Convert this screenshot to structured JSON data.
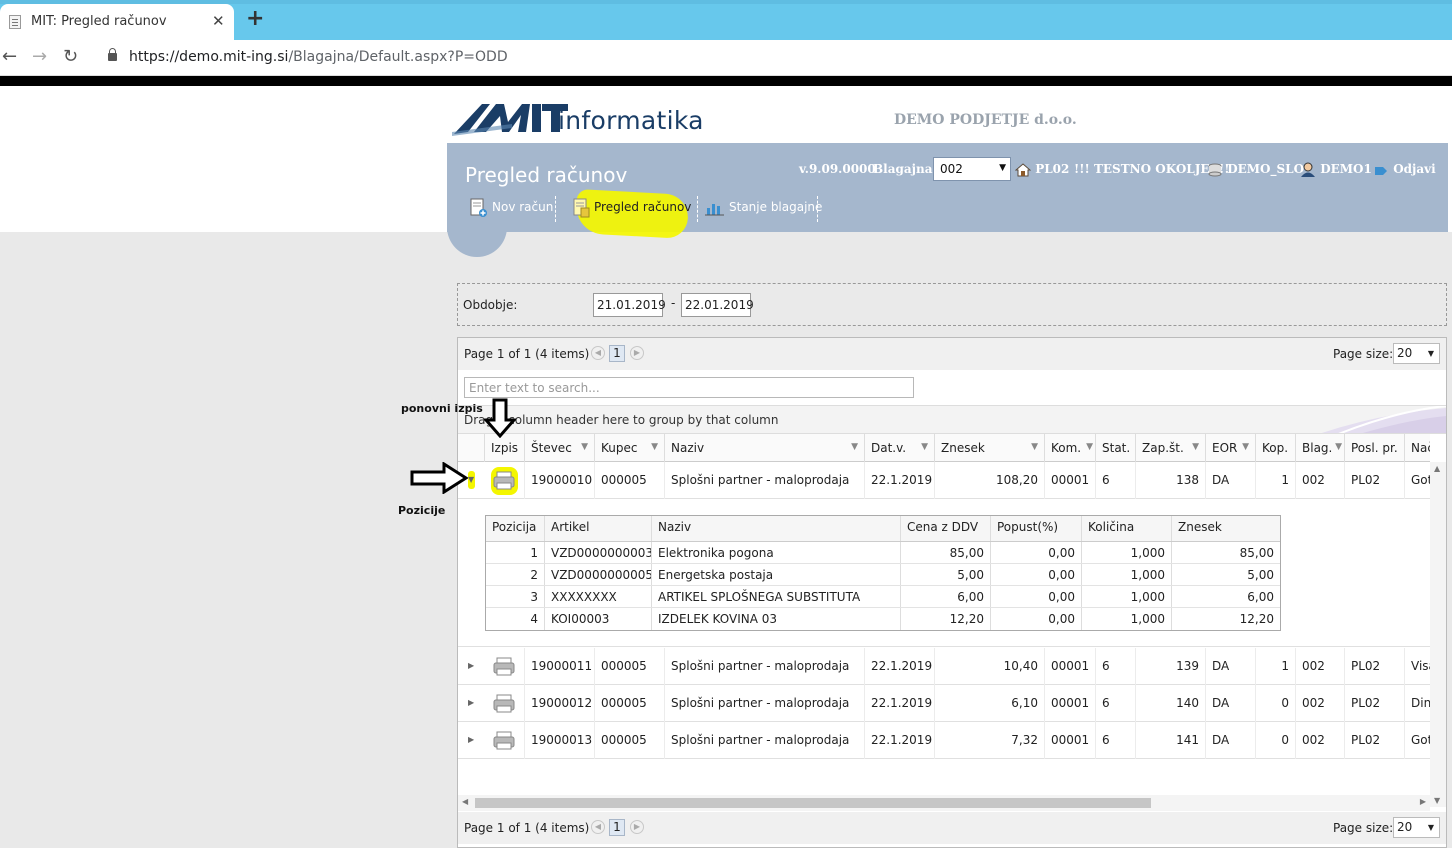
{
  "browser": {
    "tab_title": "MIT: Pregled računov",
    "url_host": "https://demo.mit-ing.si",
    "url_path": "/Blagajna/Default.aspx?P=ODD"
  },
  "brand": {
    "logo_text": "informatika",
    "company": "DEMO PODJETJE d.o.o."
  },
  "header": {
    "page_title": "Pregled računov",
    "version": "v.9.09.0000",
    "register_label": "Blagajna",
    "register_value": "002",
    "home_label": "PL02",
    "env_label": "!!! TESTNO OKOLJE !!!",
    "db_label": "DEMO_SLO",
    "user_label": "DEMO1",
    "logout_label": "Odjavi"
  },
  "menu": {
    "new_invoice": "Nov račun",
    "invoice_review": "Pregled računov",
    "cash_state": "Stanje blagajne"
  },
  "filter": {
    "period_label": "Obdobje:",
    "date_from": "21.01.2019",
    "date_to": "22.01.2019",
    "sep": "-"
  },
  "pager": {
    "info": "Page 1 of 1 (4 items)",
    "page": "1",
    "size_label": "Page size:",
    "size_value": "20"
  },
  "search": {
    "placeholder": "Enter text to search..."
  },
  "group_hint": "Drag a column header here to group by that column",
  "columns": [
    "Izpis",
    "Števec",
    "Kupec",
    "Naziv",
    "Dat.v.",
    "Znesek",
    "Kom.",
    "Stat.",
    "Zap.št.",
    "EOR",
    "Kop.",
    "Blag.",
    "Posl. pr.",
    "Nač"
  ],
  "rows": [
    {
      "stevec": "19000010",
      "kupec": "000005",
      "naziv": "Splošni partner - maloprodaja",
      "datum": "22.1.2019",
      "znesek": "108,20",
      "kom": "00001",
      "stat": "6",
      "zap": "138",
      "eor": "DA",
      "kop": "1",
      "blag": "002",
      "posl": "PL02",
      "nac": "Got"
    },
    {
      "stevec": "19000011",
      "kupec": "000005",
      "naziv": "Splošni partner - maloprodaja",
      "datum": "22.1.2019",
      "znesek": "10,40",
      "kom": "00001",
      "stat": "6",
      "zap": "139",
      "eor": "DA",
      "kop": "1",
      "blag": "002",
      "posl": "PL02",
      "nac": "Visa"
    },
    {
      "stevec": "19000012",
      "kupec": "000005",
      "naziv": "Splošni partner - maloprodaja",
      "datum": "22.1.2019",
      "znesek": "6,10",
      "kom": "00001",
      "stat": "6",
      "zap": "140",
      "eor": "DA",
      "kop": "0",
      "blag": "002",
      "posl": "PL02",
      "nac": "Din"
    },
    {
      "stevec": "19000013",
      "kupec": "000005",
      "naziv": "Splošni partner - maloprodaja",
      "datum": "22.1.2019",
      "znesek": "7,32",
      "kom": "00001",
      "stat": "6",
      "zap": "141",
      "eor": "DA",
      "kop": "0",
      "blag": "002",
      "posl": "PL02",
      "nac": "Got"
    }
  ],
  "detail": {
    "columns": [
      "Pozicija",
      "Artikel",
      "Naziv",
      "Cena z DDV",
      "Popust(%)",
      "Količina",
      "Znesek"
    ],
    "rows": [
      {
        "poz": "1",
        "artikel": "VZD0000000003",
        "naziv": "Elektronika pogona",
        "cena": "85,00",
        "popust": "0,00",
        "kolicina": "1,000",
        "znesek": "85,00"
      },
      {
        "poz": "2",
        "artikel": "VZD0000000005",
        "naziv": "Energetska postaja",
        "cena": "5,00",
        "popust": "0,00",
        "kolicina": "1,000",
        "znesek": "5,00"
      },
      {
        "poz": "3",
        "artikel": "XXXXXXXX",
        "naziv": "ARTIKEL SPLOŠNEGA SUBSTITUTA",
        "cena": "6,00",
        "popust": "0,00",
        "kolicina": "1,000",
        "znesek": "6,00"
      },
      {
        "poz": "4",
        "artikel": "KOI00003",
        "naziv": "IZDELEK KOVINA 03",
        "cena": "12,20",
        "popust": "0,00",
        "kolicina": "1,000",
        "znesek": "12,20"
      }
    ]
  },
  "annotations": {
    "reprint": "ponovni izpis",
    "positions": "Pozicije"
  },
  "colors": {
    "header_bg": "#a5b7cd",
    "highlight": "#f4f600",
    "tabbar": "#67c8ec",
    "brand": "#1a3d66"
  }
}
